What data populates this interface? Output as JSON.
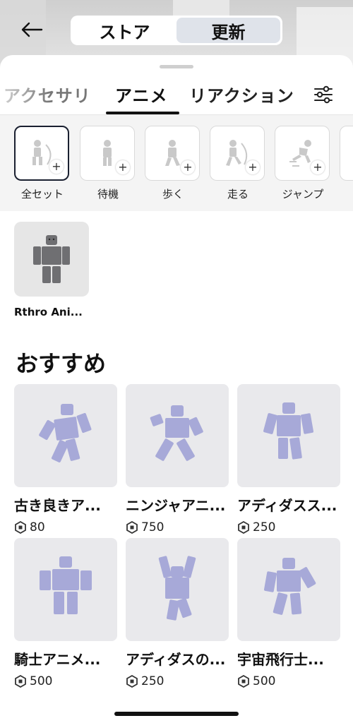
{
  "header": {
    "back_icon": "arrow-left-icon",
    "segments": [
      {
        "label": "ストア",
        "active": false
      },
      {
        "label": "更新",
        "active": true
      }
    ]
  },
  "tabs": [
    {
      "label": "アクセサリ",
      "active": false
    },
    {
      "label": "アニメ",
      "active": true
    },
    {
      "label": "リアクション",
      "active": false
    }
  ],
  "filter_icon": "sliders-icon",
  "categories": [
    {
      "label": "全セット",
      "selected": true,
      "icon": "full-set-icon"
    },
    {
      "label": "待機",
      "selected": false,
      "icon": "idle-icon"
    },
    {
      "label": "歩く",
      "selected": false,
      "icon": "walk-icon"
    },
    {
      "label": "走る",
      "selected": false,
      "icon": "run-icon"
    },
    {
      "label": "ジャンプ",
      "selected": false,
      "icon": "jump-icon"
    }
  ],
  "owned": {
    "name": "Rthro Ani..."
  },
  "recommended": {
    "title": "おすすめ",
    "items": [
      {
        "name": "古き良きア...",
        "price": "80"
      },
      {
        "name": "ニンジャアニ...",
        "price": "750"
      },
      {
        "name": "アディダスス...",
        "price": "250"
      },
      {
        "name": "騎士アニメ...",
        "price": "500"
      },
      {
        "name": "アディダスの...",
        "price": "250"
      },
      {
        "name": "宇宙飛行士...",
        "price": "500"
      }
    ]
  },
  "colors": {
    "accent": "#1a2030",
    "avatar": "#a7a9d8",
    "card_bg": "#e9e9ec"
  }
}
